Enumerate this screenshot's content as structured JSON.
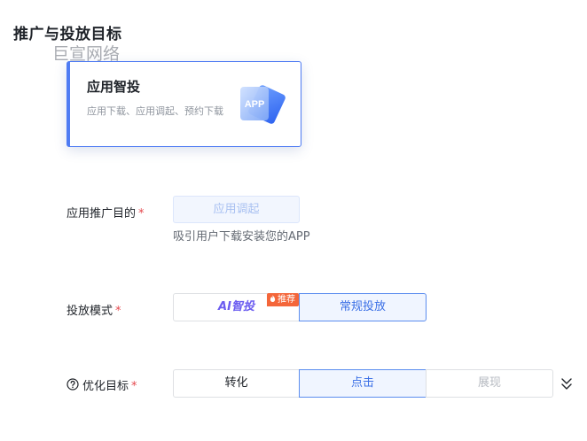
{
  "section": {
    "title": "推广与投放目标",
    "watermark": "巨宣网络"
  },
  "card": {
    "title": "应用智投",
    "desc": "应用下载、应用调起、预约下载",
    "icon": "app-icon",
    "icon_text": "APP"
  },
  "purpose": {
    "label": "应用推广目的",
    "required_mark": "*",
    "value": "应用调起",
    "helper": "吸引用户下载安装您的APP"
  },
  "mode": {
    "label": "投放模式",
    "required_mark": "*",
    "options": [
      "AI智投",
      "常规投放"
    ],
    "selected": "常规投放",
    "badge": "推荐"
  },
  "goal": {
    "label": "优化目标",
    "required_mark": "*",
    "options": [
      "转化",
      "点击",
      "展现"
    ],
    "selected": "点击",
    "disabled": "展现",
    "help_icon": "question-circle-icon",
    "expand_icon": "double-chevron-down-icon"
  },
  "colors": {
    "accent": "#4f7cf3",
    "required": "#e5484d",
    "badge": "#f4663a",
    "ai": "#6b5cf0"
  }
}
